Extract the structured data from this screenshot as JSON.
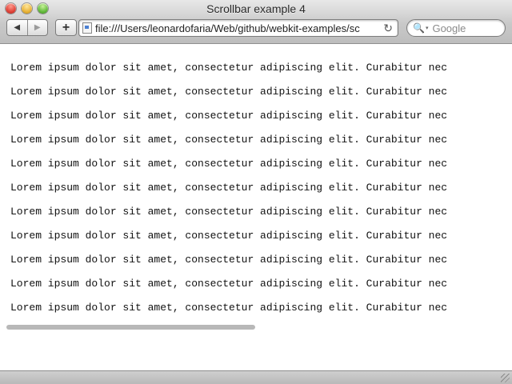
{
  "window": {
    "title": "Scrollbar example 4"
  },
  "toolbar": {
    "back_glyph": "◀",
    "forward_glyph": "▶",
    "add_glyph": "+",
    "url": "file:///Users/leonardofaria/Web/github/webkit-examples/sc",
    "reload_glyph": "↻",
    "search_placeholder": "Google",
    "search_glyph": "🔍",
    "search_caret_glyph": "▾"
  },
  "content": {
    "lines": [
      "Lorem ipsum dolor sit amet, consectetur adipiscing elit. Curabitur nec",
      "Lorem ipsum dolor sit amet, consectetur adipiscing elit. Curabitur nec",
      "Lorem ipsum dolor sit amet, consectetur adipiscing elit. Curabitur nec",
      "Lorem ipsum dolor sit amet, consectetur adipiscing elit. Curabitur nec",
      "Lorem ipsum dolor sit amet, consectetur adipiscing elit. Curabitur nec",
      "Lorem ipsum dolor sit amet, consectetur adipiscing elit. Curabitur nec",
      "Lorem ipsum dolor sit amet, consectetur adipiscing elit. Curabitur nec",
      "Lorem ipsum dolor sit amet, consectetur adipiscing elit. Curabitur nec",
      "Lorem ipsum dolor sit amet, consectetur adipiscing elit. Curabitur nec",
      "Lorem ipsum dolor sit amet, consectetur adipiscing elit. Curabitur nec",
      "Lorem ipsum dolor sit amet, consectetur adipiscing elit. Curabitur nec"
    ]
  },
  "icons": {
    "close": "close-icon",
    "minimize": "minimize-icon",
    "zoom": "zoom-icon",
    "page": "page-icon",
    "reload": "reload-icon",
    "search": "search-icon"
  },
  "colors": {
    "close": "#e0443a",
    "minimize": "#e9b43a",
    "zoom": "#65bb3e",
    "scrollbar_thumb": "#b8b8b8"
  }
}
